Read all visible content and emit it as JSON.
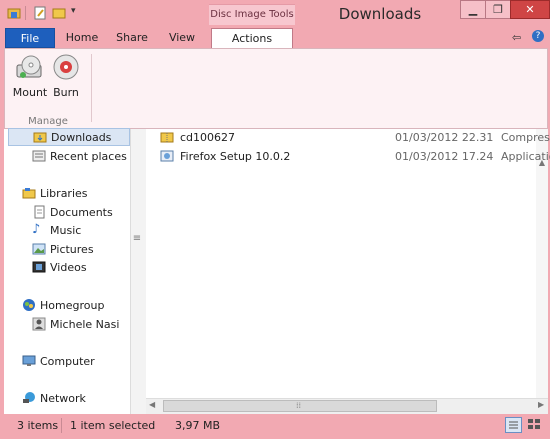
{
  "window": {
    "title": "Downloads",
    "contextual_group": "Disc Image Tools",
    "controls": [
      "minimize",
      "restore",
      "close"
    ]
  },
  "ribbon": {
    "tabs": [
      "File",
      "Home",
      "Share",
      "View",
      "Actions"
    ],
    "active_tab": "Actions",
    "buttons": {
      "mount": "Mount",
      "burn": "Burn"
    },
    "group_label": "Manage"
  },
  "nav": {
    "quick_access": [
      "Downloads",
      "Recent places"
    ],
    "libraries_label": "Libraries",
    "libraries": [
      "Documents",
      "Music",
      "Pictures",
      "Videos"
    ],
    "homegroup_label": "Homegroup",
    "homegroup_user": "Michele Nasi",
    "computer_label": "Computer",
    "network_label": "Network"
  },
  "files": [
    {
      "name": "cd100627",
      "date": "01/03/2012 22.31",
      "type": "Compress",
      "icon": "zip-folder-icon"
    },
    {
      "name": "Firefox Setup 10.0.2",
      "date": "01/03/2012 17.24",
      "type": "Applicatio",
      "icon": "installer-icon"
    }
  ],
  "status": {
    "items": "3 items",
    "selection": "1 item selected",
    "size": "3,97 MB"
  },
  "colors": {
    "frame": "#f2a9b2",
    "file_tab": "#1e5fbd",
    "selection": "#dbe6f4"
  }
}
